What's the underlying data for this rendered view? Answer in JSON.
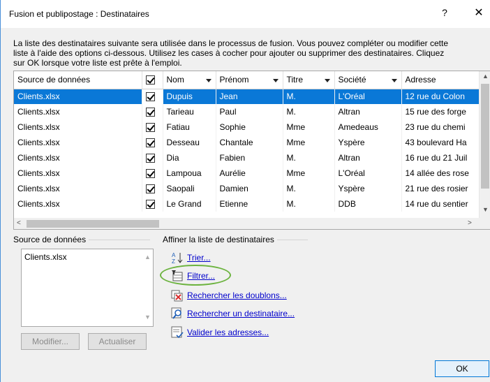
{
  "window": {
    "title": "Fusion et publipostage : Destinataires",
    "help_label": "?",
    "close_label": "✕"
  },
  "intro": {
    "line1": "La liste des destinataires suivante sera utilisée dans le processus de fusion. Vous pouvez compléter ou modifier cette",
    "line2": "liste à l'aide des options ci-dessous. Utilisez les cases à cocher pour ajouter ou supprimer des destinataires. Cliquez",
    "line3": "sur OK lorsque votre liste est prête à l'emploi."
  },
  "grid": {
    "headers": {
      "source": "Source de données",
      "nom": "Nom",
      "prenom": "Prénom",
      "titre": "Titre",
      "societe": "Société",
      "adresse": "Adresse"
    },
    "rows": [
      {
        "source": "Clients.xlsx",
        "nom": "Dupuis",
        "prenom": "Jean",
        "titre": "M.",
        "societe": "L'Oréal",
        "adresse": "12 rue du Colon"
      },
      {
        "source": "Clients.xlsx",
        "nom": "Tarieau",
        "prenom": "Paul",
        "titre": "M.",
        "societe": "Altran",
        "adresse": "15 rue des forge"
      },
      {
        "source": "Clients.xlsx",
        "nom": "Fatiau",
        "prenom": "Sophie",
        "titre": "Mme",
        "societe": "Amedeaus",
        "adresse": "23 rue du chemi"
      },
      {
        "source": "Clients.xlsx",
        "nom": "Desseau",
        "prenom": "Chantale",
        "titre": "Mme",
        "societe": "Yspère",
        "adresse": "43 boulevard Ha"
      },
      {
        "source": "Clients.xlsx",
        "nom": "Dia",
        "prenom": "Fabien",
        "titre": "M.",
        "societe": "Altran",
        "adresse": "16 rue du 21 Juil"
      },
      {
        "source": "Clients.xlsx",
        "nom": "Lampoua",
        "prenom": "Aurélie",
        "titre": "Mme",
        "societe": "L'Oréal",
        "adresse": "14 allée des rose"
      },
      {
        "source": "Clients.xlsx",
        "nom": "Saopali",
        "prenom": "Damien",
        "titre": "M.",
        "societe": "Yspère",
        "adresse": "21 rue des rosier"
      },
      {
        "source": "Clients.xlsx",
        "nom": "Le Grand",
        "prenom": "Etienne",
        "titre": "M.",
        "societe": "DDB",
        "adresse": "14 rue du sentier"
      }
    ]
  },
  "source_group": {
    "label": "Source de données",
    "items": [
      "Clients.xlsx"
    ],
    "modify_button": "Modifier...",
    "refresh_button": "Actualiser"
  },
  "refine_group": {
    "label": "Affiner la liste de destinataires",
    "sort": "Trier...",
    "filter": "Filtrer...",
    "duplicates": "Rechercher les doublons...",
    "find": "Rechercher un destinataire...",
    "validate": "Valider les adresses..."
  },
  "footer": {
    "ok_button": "OK"
  },
  "colors": {
    "selection": "#0a78d7",
    "link": "#0000cc",
    "highlight_ring": "#6cb33f"
  }
}
